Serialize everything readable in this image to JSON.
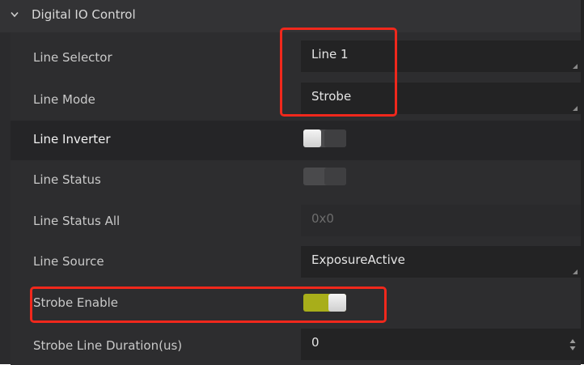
{
  "section": {
    "title": "Digital IO Control",
    "expanded_icon": "chevron-down-icon"
  },
  "rows": {
    "line_selector": {
      "label": "Line Selector",
      "value": "Line 1"
    },
    "line_mode": {
      "label": "Line Mode",
      "value": "Strobe"
    },
    "line_inverter": {
      "label": "Line Inverter",
      "state": "off"
    },
    "line_status": {
      "label": "Line Status",
      "state": "off"
    },
    "line_status_all": {
      "label": "Line Status All",
      "value": "0x0"
    },
    "line_source": {
      "label": "Line Source",
      "value": "ExposureActive"
    },
    "strobe_enable": {
      "label": "Strobe Enable",
      "state": "on"
    },
    "strobe_line_duration": {
      "label": "Strobe Line Duration(us)",
      "value": "0"
    }
  },
  "colors": {
    "annotation": "#f0281c",
    "toggle_on": "#a8ae1a",
    "background": "#2d2d2f"
  }
}
